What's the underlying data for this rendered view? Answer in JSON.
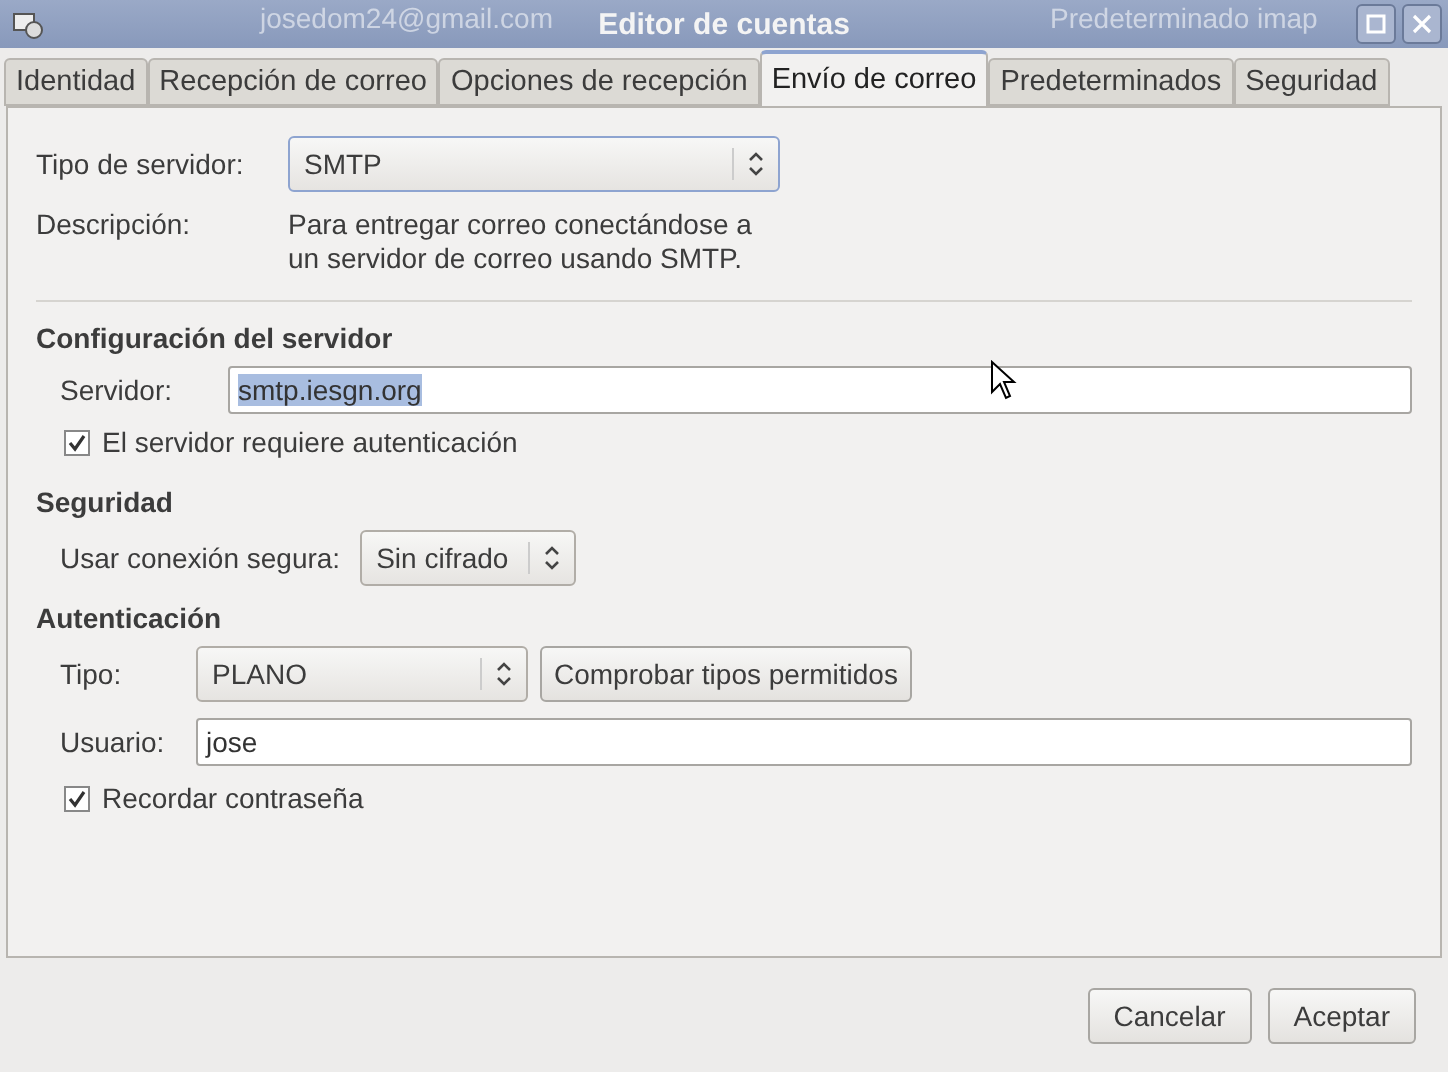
{
  "window": {
    "title": "Editor de cuentas",
    "background_texts": [
      "josedom24@gmail.com",
      "Predeterminado  imap"
    ]
  },
  "tabs": [
    {
      "label": "Identidad",
      "selected": false
    },
    {
      "label": "Recepción de correo",
      "selected": false
    },
    {
      "label": "Opciones de recepción",
      "selected": false
    },
    {
      "label": "Envío de correo",
      "selected": true
    },
    {
      "label": "Predeterminados",
      "selected": false
    },
    {
      "label": "Seguridad",
      "selected": false
    }
  ],
  "server_type": {
    "label": "Tipo de servidor:",
    "value": "SMTP"
  },
  "description": {
    "label": "Descripción:",
    "text": "Para entregar correo conectándose a\nun servidor de correo usando SMTP."
  },
  "server_config": {
    "heading": "Configuración del servidor",
    "server_label": "Servidor:",
    "server_value": "smtp.iesgn.org",
    "value_selected": true,
    "auth_required": {
      "label": "El servidor requiere autenticación",
      "checked": true
    }
  },
  "security": {
    "heading": "Seguridad",
    "connection_label": "Usar conexión segura:",
    "connection_value": "Sin cifrado"
  },
  "authentication": {
    "heading": "Autenticación",
    "type_label": "Tipo:",
    "type_value": "PLANO",
    "check_button": "Comprobar tipos permitidos",
    "user_label": "Usuario:",
    "user_value": "jose",
    "remember_password": {
      "label": "Recordar contraseña",
      "checked": true
    }
  },
  "buttons": [
    "Cancelar",
    "Aceptar"
  ]
}
